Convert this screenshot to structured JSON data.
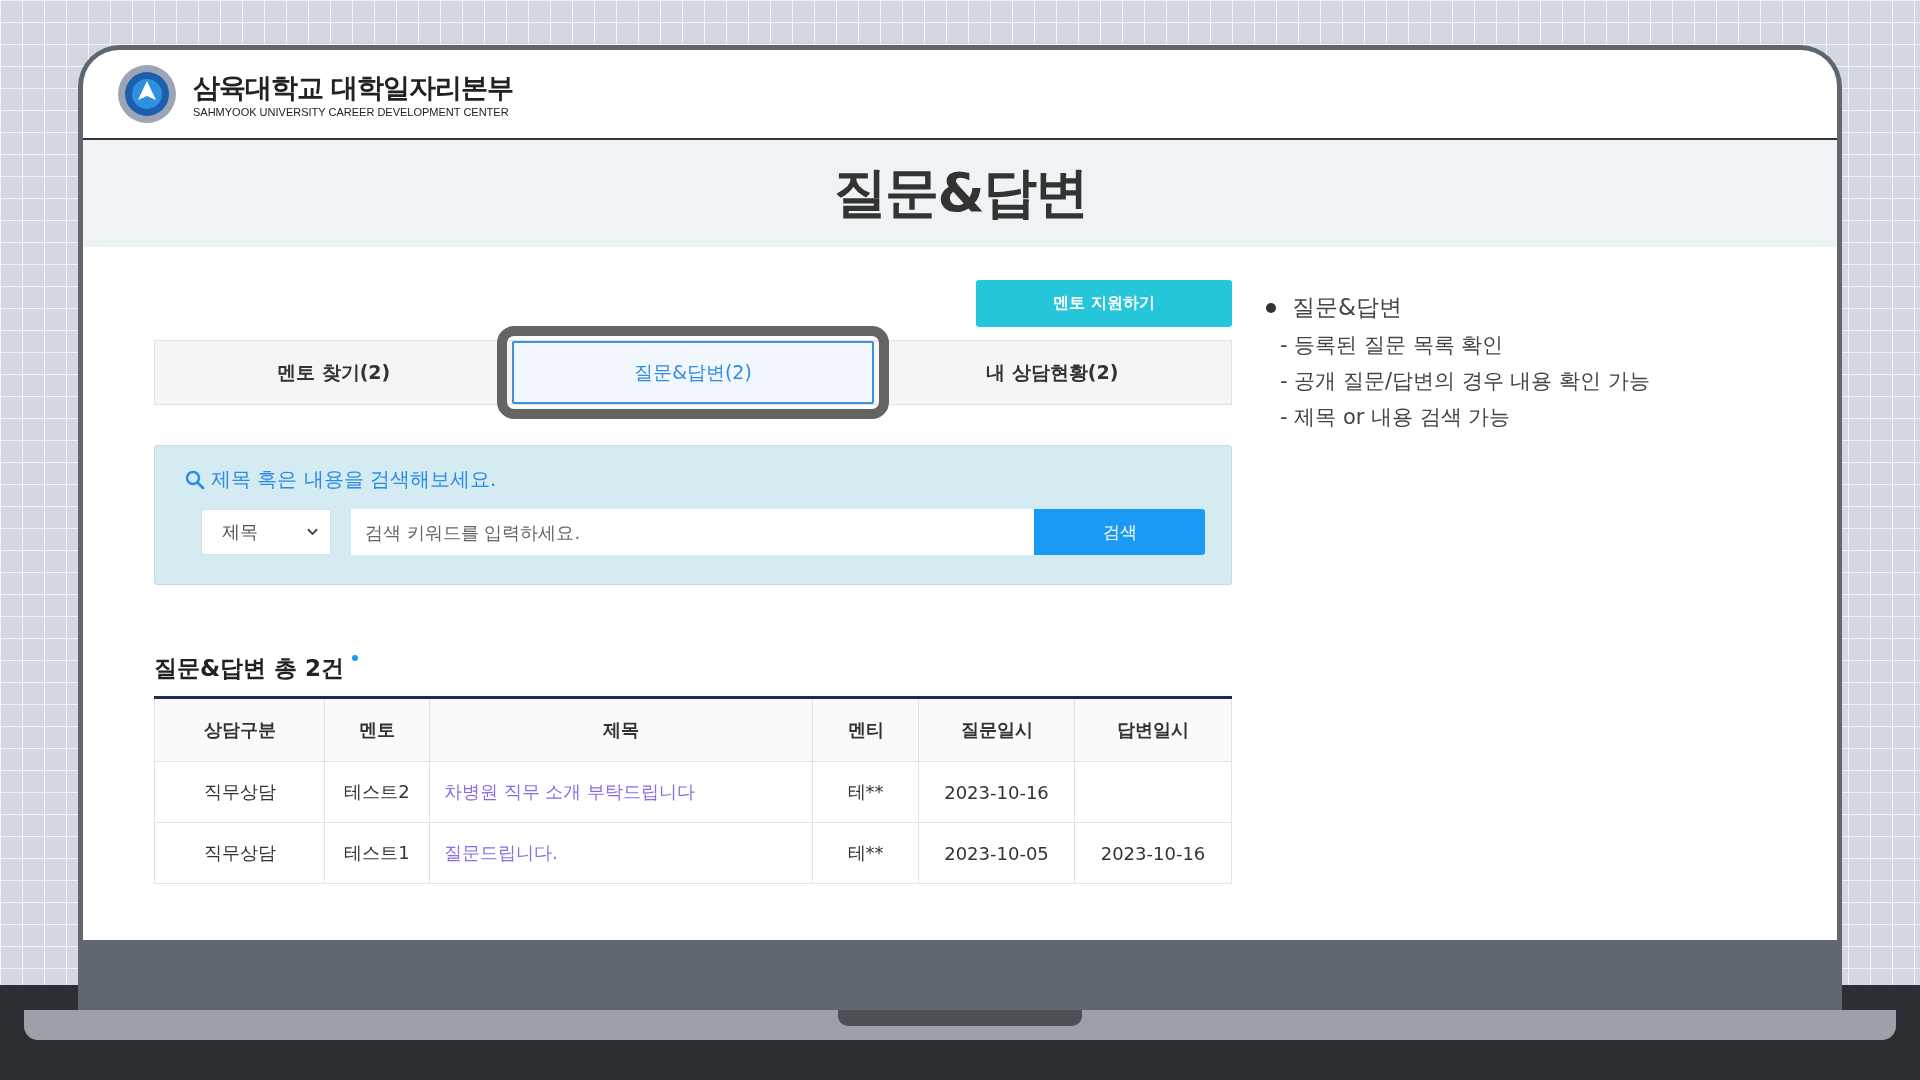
{
  "header": {
    "title": "삼육대학교 대학일자리본부",
    "subtitle": "SAHMYOOK UNIVERSITY CAREER DEVELOPMENT CENTER"
  },
  "page_title": "질문&답변",
  "apply_button": "멘토 지원하기",
  "tabs": [
    {
      "label": "멘토 찾기(2)",
      "selected": false,
      "highlighted": false
    },
    {
      "label": "질문&답변(2)",
      "selected": true,
      "highlighted": true
    },
    {
      "label": "내 상담현황(2)",
      "selected": false,
      "highlighted": false
    }
  ],
  "search": {
    "prompt": "제목 혹은 내용을 검색해보세요.",
    "filter": "제목",
    "placeholder": "검색 키워드를 입력하세요.",
    "button": "검색"
  },
  "list_heading": "질문&답변 총 2건",
  "table": {
    "columns": [
      "상담구분",
      "멘토",
      "제목",
      "멘티",
      "질문일시",
      "답변일시"
    ],
    "rows": [
      [
        "직무상담",
        "테스트2",
        "차병원 직무 소개 부탁드립니다",
        "테**",
        "2023-10-16",
        ""
      ],
      [
        "직무상담",
        "테스트1",
        "질문드립니다.",
        "테**",
        "2023-10-05",
        "2023-10-16"
      ]
    ]
  },
  "notes": {
    "title": "질문&답변",
    "lines": [
      "- 등록된 질문 목록 확인",
      "- 공개 질문/답변의 경우 내용 확인 가능",
      "- 제목 or 내용 검색 가능"
    ]
  }
}
